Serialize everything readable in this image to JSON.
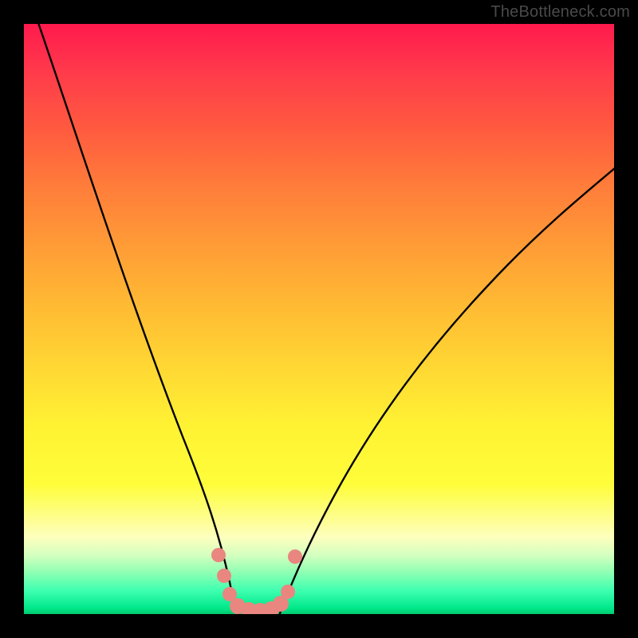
{
  "watermark": "TheBottleneck.com",
  "chart_data": {
    "type": "line",
    "title": "",
    "xlabel": "",
    "ylabel": "",
    "xlim": [
      0,
      100
    ],
    "ylim": [
      0,
      100
    ],
    "background_gradient": {
      "direction": "vertical",
      "stops": [
        {
          "pos": 0,
          "color": "#ff1a4d"
        },
        {
          "pos": 50,
          "color": "#ffe233"
        },
        {
          "pos": 88,
          "color": "#fdffbe"
        },
        {
          "pos": 100,
          "color": "#00c86e"
        }
      ]
    },
    "series": [
      {
        "name": "left-branch",
        "x": [
          2,
          5,
          8,
          11,
          14,
          17,
          20,
          23,
          26,
          28,
          30,
          32,
          33.5,
          35
        ],
        "y": [
          100,
          93,
          86,
          79,
          72,
          64,
          56,
          47,
          38,
          30,
          22,
          14,
          7,
          0
        ]
      },
      {
        "name": "right-branch",
        "x": [
          42,
          45,
          50,
          55,
          60,
          65,
          70,
          75,
          80,
          85,
          90,
          95,
          100
        ],
        "y": [
          0,
          6,
          15,
          24,
          32,
          40,
          47,
          53,
          59,
          64,
          69,
          73,
          77
        ]
      },
      {
        "name": "floor",
        "x": [
          35,
          37,
          39,
          41,
          42
        ],
        "y": [
          0,
          0,
          0,
          0,
          0
        ]
      }
    ],
    "markers": {
      "name": "bottom-dots",
      "color": "#e9867f",
      "points": [
        {
          "x": 32.5,
          "y": 10
        },
        {
          "x": 33.5,
          "y": 6
        },
        {
          "x": 34.5,
          "y": 2
        },
        {
          "x": 36,
          "y": 0.5
        },
        {
          "x": 37.5,
          "y": 0.3
        },
        {
          "x": 39,
          "y": 0.3
        },
        {
          "x": 40.5,
          "y": 0.5
        },
        {
          "x": 42,
          "y": 1.5
        },
        {
          "x": 43,
          "y": 4
        },
        {
          "x": 44.5,
          "y": 10
        }
      ]
    }
  }
}
